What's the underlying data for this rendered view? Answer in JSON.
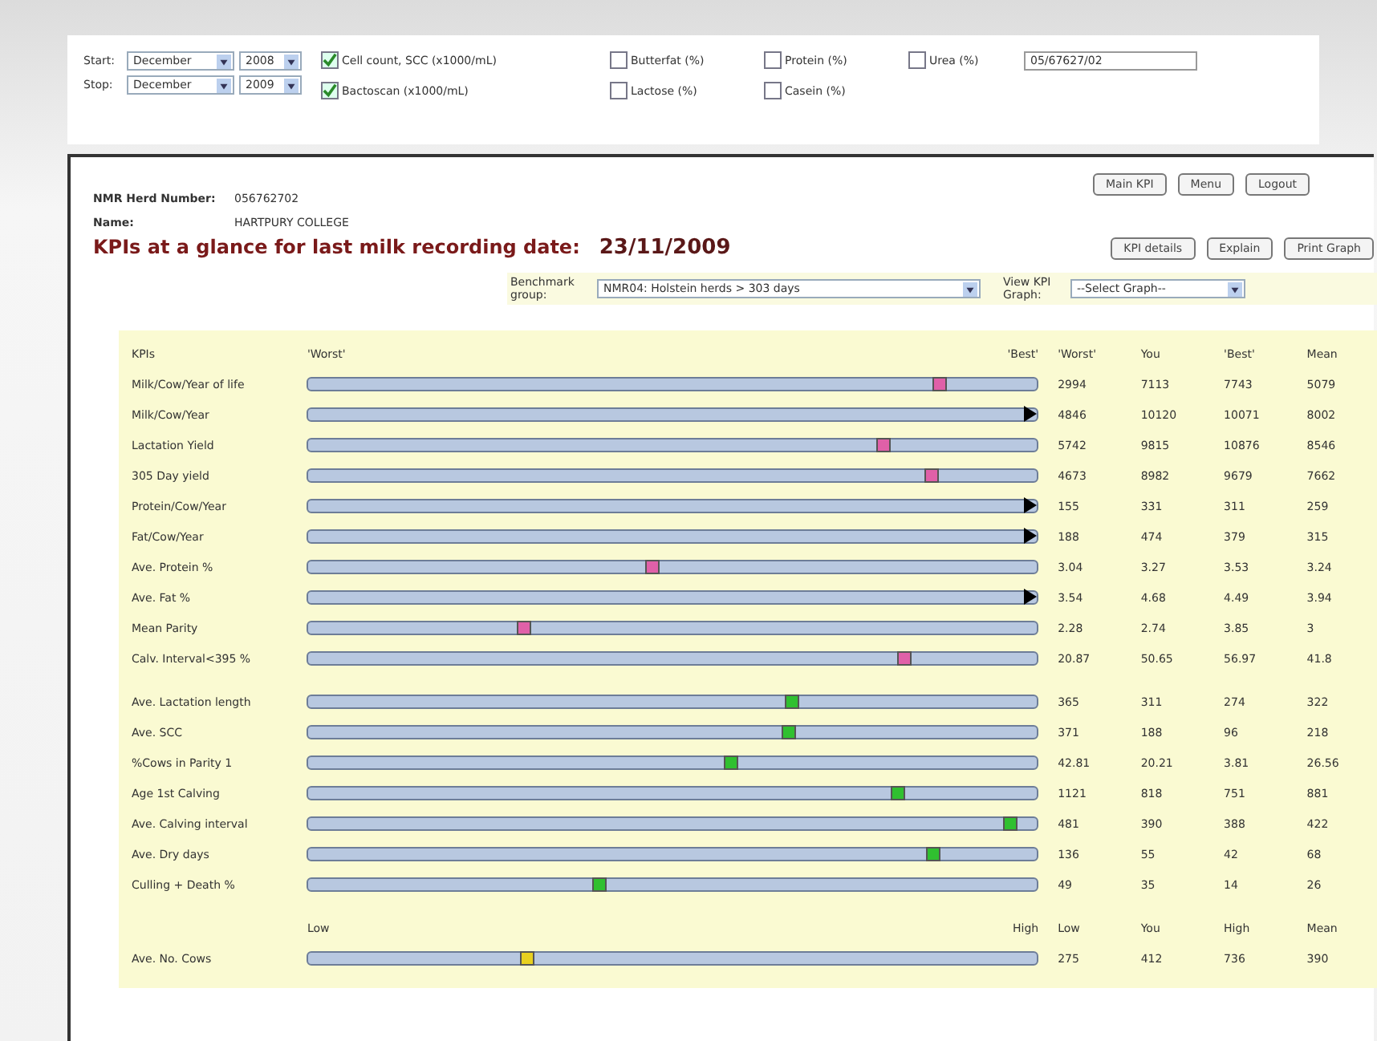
{
  "filters": {
    "start_label": "Start:",
    "start_month": "December",
    "start_year": "2008",
    "stop_label": "Stop:",
    "stop_month": "December",
    "stop_year": "2009",
    "checkboxes": [
      {
        "label": "Cell count, SCC (x1000/mL)",
        "checked": true
      },
      {
        "label": "Butterfat (%)",
        "checked": false
      },
      {
        "label": "Protein (%)",
        "checked": false
      },
      {
        "label": "Urea (%)",
        "checked": false
      },
      {
        "label": "Bactoscan (x1000/mL)",
        "checked": true
      },
      {
        "label": "Lactose (%)",
        "checked": false
      },
      {
        "label": "Casein (%)",
        "checked": false
      }
    ],
    "herd_field": "05/67627/02"
  },
  "nav_buttons": [
    "Main KPI",
    "Menu",
    "Logout"
  ],
  "herd_number_label": "NMR Herd Number:",
  "herd_number": "056762702",
  "name_label": "Name:",
  "name": "HARTPURY COLLEGE",
  "title": "KPIs at a glance for last milk recording date:",
  "date": "23/11/2009",
  "action_buttons": [
    "KPI details",
    "Explain",
    "Print Graph"
  ],
  "benchmark_label": "Benchmark group:",
  "benchmark_value": "NMR04: Holstein herds > 303 days",
  "graph_label": "View KPI Graph:",
  "graph_value": "--Select Graph--",
  "sections": [
    {
      "header": {
        "title": "KPIs",
        "scale": [
          "'Worst'",
          "'Best'"
        ],
        "columns": [
          "'Worst'",
          "You",
          "'Best'",
          "Mean"
        ]
      },
      "rows": [
        {
          "label": "Milk/Cow/Year of life",
          "kind": "marker",
          "level": 0.867,
          "color": "#e060a8",
          "values": [
            "2994",
            "7113",
            "7743",
            "5079"
          ]
        },
        {
          "label": "Milk/Cow/Year",
          "kind": "arrow",
          "level": 1,
          "color": "#000000",
          "values": [
            "4846",
            "10120",
            "10071",
            "8002"
          ]
        },
        {
          "label": "Lactation Yield",
          "kind": "marker",
          "level": 0.79,
          "color": "#e060a8",
          "values": [
            "5742",
            "9815",
            "10876",
            "8546"
          ]
        },
        {
          "label": "305 Day yield",
          "kind": "marker",
          "level": 0.856,
          "color": "#e060a8",
          "values": [
            "4673",
            "8982",
            "9679",
            "7662"
          ]
        },
        {
          "label": "Protein/Cow/Year",
          "kind": "arrow",
          "level": 1,
          "color": "#000000",
          "values": [
            "155",
            "331",
            "311",
            "259"
          ]
        },
        {
          "label": "Fat/Cow/Year",
          "kind": "arrow",
          "level": 1,
          "color": "#000000",
          "values": [
            "188",
            "474",
            "379",
            "315"
          ]
        },
        {
          "label": "Ave. Protein %",
          "kind": "marker",
          "level": 0.474,
          "color": "#e060a8",
          "values": [
            "3.04",
            "3.27",
            "3.53",
            "3.24"
          ]
        },
        {
          "label": "Ave. Fat %",
          "kind": "arrow",
          "level": 1,
          "color": "#000000",
          "values": [
            "3.54",
            "4.68",
            "4.49",
            "3.94"
          ]
        },
        {
          "label": "Mean Parity",
          "kind": "marker",
          "level": 0.297,
          "color": "#e060a8",
          "values": [
            "2.28",
            "2.74",
            "3.85",
            "3"
          ]
        },
        {
          "label": "Calv. Interval<395 %",
          "kind": "marker",
          "level": 0.82,
          "color": "#e060a8",
          "values": [
            "20.87",
            "50.65",
            "56.97",
            "41.8"
          ]
        }
      ]
    },
    {
      "rows": [
        {
          "label": "Ave. Lactation length",
          "kind": "marker",
          "level": 0.664,
          "color": "#30c030",
          "values": [
            "365",
            "311",
            "274",
            "322"
          ]
        },
        {
          "label": "Ave. SCC",
          "kind": "marker",
          "level": 0.66,
          "color": "#30c030",
          "values": [
            "371",
            "188",
            "96",
            "218"
          ]
        },
        {
          "label": "%Cows in Parity 1",
          "kind": "marker",
          "level": 0.58,
          "color": "#30c030",
          "values": [
            "42.81",
            "20.21",
            "3.81",
            "26.56"
          ]
        },
        {
          "label": "Age 1st Calving",
          "kind": "marker",
          "level": 0.81,
          "color": "#30c030",
          "values": [
            "1121",
            "818",
            "751",
            "881"
          ]
        },
        {
          "label": "Ave. Calving interval",
          "kind": "marker",
          "level": 0.965,
          "color": "#30c030",
          "values": [
            "481",
            "390",
            "388",
            "422"
          ]
        },
        {
          "label": "Ave. Dry days",
          "kind": "marker",
          "level": 0.858,
          "color": "#30c030",
          "values": [
            "136",
            "55",
            "42",
            "68"
          ]
        },
        {
          "label": "Culling + Death %",
          "kind": "marker",
          "level": 0.4,
          "color": "#30c030",
          "values": [
            "49",
            "35",
            "14",
            "26"
          ]
        }
      ]
    },
    {
      "header": {
        "scale": [
          "Low",
          "High"
        ],
        "columns": [
          "Low",
          "You",
          "High",
          "Mean"
        ]
      },
      "rows": [
        {
          "label": "Ave. No. Cows",
          "kind": "marker",
          "level": 0.3,
          "color": "#e8d020",
          "values": [
            "275",
            "412",
            "736",
            "390"
          ]
        }
      ]
    }
  ]
}
